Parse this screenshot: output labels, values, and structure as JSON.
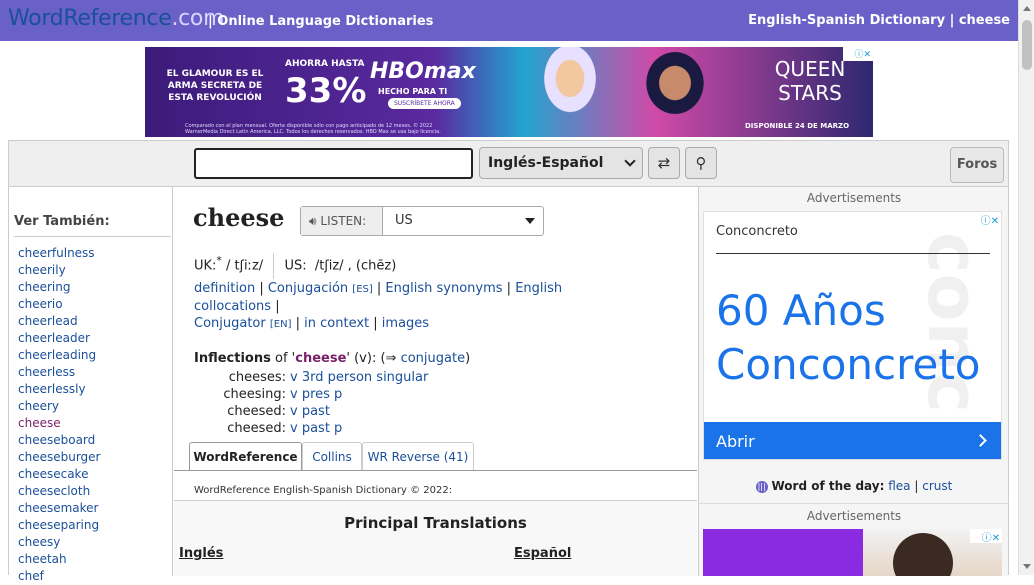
{
  "header": {
    "logo_main": "WordReference",
    "logo_suffix": ".com",
    "tagline": "| Online Language Dictionaries",
    "dictionary_link": "English-Spanish Dictionary | cheese"
  },
  "top_ad": {
    "text1": "EL GLAMOUR ES EL ARMA SECRETA DE ESTA REVOLUCIÓN",
    "text2": "AHORRA HASTA",
    "percent": "33%",
    "brand": "HBOmax",
    "brand_sub": "HECHO PARA TI",
    "cta": "SUSCRÍBETE AHORA",
    "fine_print": "Comparado con el plan mensual. Oferta disponible sólo con pago anticipado de 12 meses. © 2022 WarnerMedia Direct Latin America, LLC. Todos los derechos reservados. HBO Max se usa bajo licencia.",
    "show": "QUEEN STARS",
    "show_sub": "DISPONIBLE 24 DE MARZO"
  },
  "search": {
    "value": "",
    "language": "Inglés-Español",
    "swap_glyph": "⇄",
    "search_glyph": "⚲",
    "forums_label": "Foros"
  },
  "see_also": {
    "title": "Ver También:",
    "items": [
      "cheerfulness",
      "cheerily",
      "cheering",
      "cheerio",
      "cheerlead",
      "cheerleader",
      "cheerleading",
      "cheerless",
      "cheerlessly",
      "cheery",
      "cheese",
      "cheeseboard",
      "cheeseburger",
      "cheesecake",
      "cheesecloth",
      "cheesemaker",
      "cheeseparing",
      "cheesy",
      "cheetah",
      "chef"
    ]
  },
  "entry": {
    "headword": "cheese",
    "listen_label": "LISTEN:",
    "accent": "US",
    "uk_label": "UK:",
    "uk_pron": "/ tʃiːz/",
    "us_label": "US:",
    "us_pron": "/tʃiz/ ,  (chēz)",
    "links": {
      "definition": "definition",
      "conjugacion": "Conjugación",
      "conjugacion_tag": "[ES]",
      "synonyms": "English synonyms",
      "collocations": "English collocations",
      "conjugator": "Conjugator",
      "conjugator_tag": "[EN]",
      "in_context": "in context",
      "images": "images"
    },
    "inflections": {
      "label": "Inflections",
      "of": "of '",
      "word": "cheese",
      "pos": "' (v): (⇒",
      "conjugate": "conjugate",
      "close": ")",
      "rows": [
        {
          "form": "cheeses:",
          "desc": "v 3rd person singular"
        },
        {
          "form": "cheesing:",
          "desc": "v pres p"
        },
        {
          "form": "cheesed:",
          "desc": "v past"
        },
        {
          "form": "cheesed:",
          "desc": "v past p"
        }
      ]
    },
    "tabs": [
      "WordReference",
      "Collins",
      "WR Reverse (41)"
    ],
    "copyright": "WordReference English-Spanish Dictionary © 2022:",
    "principal_title": "Principal Translations",
    "col_en": "Inglés",
    "col_es": "Español"
  },
  "right": {
    "ad_label": "Advertisements",
    "ad_brand": "Conconcreto",
    "ad_line1": "60 Años",
    "ad_line2": "Conconcreto",
    "ad_cta": "Abrir",
    "wotd_label": "Word of the day:",
    "wotd_word1": "flea",
    "wotd_sep": "|",
    "wotd_word2": "crust",
    "ad_label2": "Advertisements"
  }
}
